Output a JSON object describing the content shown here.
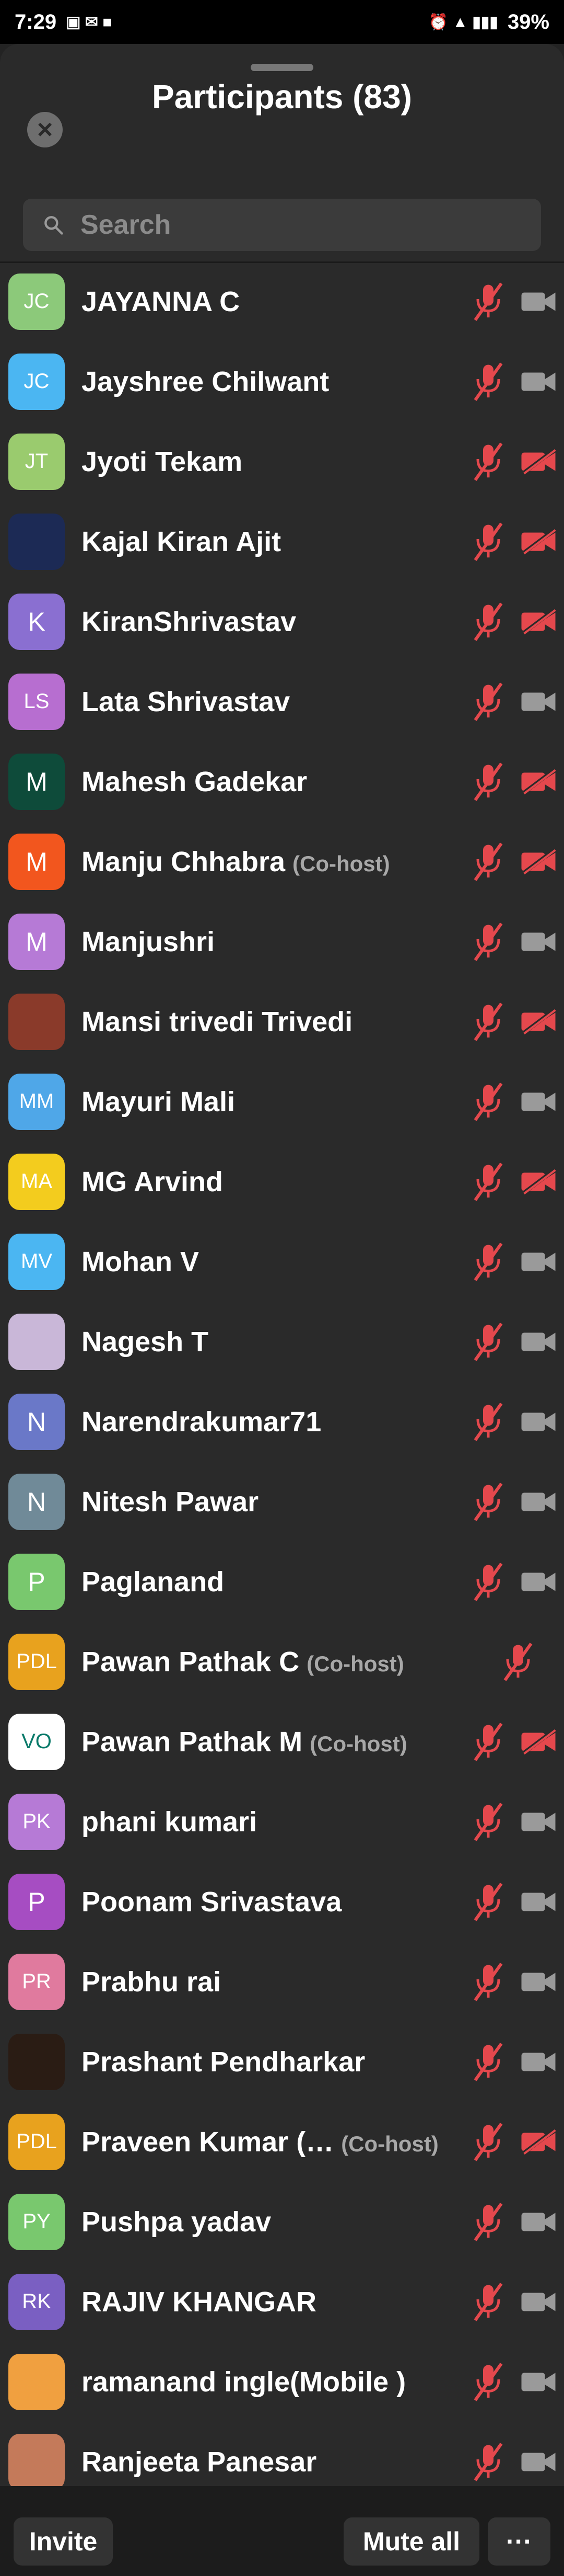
{
  "status_bar": {
    "time": "7:29",
    "battery": "39%"
  },
  "header": {
    "title": "Participants (83)"
  },
  "search": {
    "placeholder": "Search"
  },
  "colors": {
    "muted_red": "#e5484d",
    "video_on": "#9a9a9a",
    "background": "#2a2a2a"
  },
  "participants": [
    {
      "name": "JAYANNA C",
      "initials": "JC",
      "avatar_color": "#8cc97a",
      "video": "on"
    },
    {
      "name": "Jayshree Chilwant",
      "initials": "JC",
      "avatar_color": "#4bb6f2",
      "video": "on"
    },
    {
      "name": "Jyoti Tekam",
      "initials": "JT",
      "avatar_color": "#9acb6e",
      "video": "off"
    },
    {
      "name": "Kajal Kiran Ajit",
      "initials": "",
      "avatar_color": "#1c2a55",
      "video": "off"
    },
    {
      "name": "KiranShrivastav",
      "initials": "K",
      "avatar_color": "#8a6fd1",
      "video": "off"
    },
    {
      "name": "Lata Shrivastav",
      "initials": "LS",
      "avatar_color": "#b76ed0",
      "video": "on"
    },
    {
      "name": "Mahesh Gadekar",
      "initials": "M",
      "avatar_color": "#0e4b3a",
      "video": "off"
    },
    {
      "name": "Manju Chhabra",
      "cohost": "(Co-host)",
      "initials": "M",
      "avatar_color": "#f2561e",
      "video": "off"
    },
    {
      "name": "Manjushri",
      "initials": "M",
      "avatar_color": "#b67ad6",
      "video": "on"
    },
    {
      "name": "Mansi trivedi Trivedi",
      "initials": "",
      "avatar_color": "#8a3a2a",
      "video": "off"
    },
    {
      "name": "Mayuri Mali",
      "initials": "MM",
      "avatar_color": "#4fa7e8",
      "video": "on"
    },
    {
      "name": "MG Arvind",
      "initials": "MA",
      "avatar_color": "#f3cc1e",
      "video": "off"
    },
    {
      "name": "Mohan V",
      "initials": "MV",
      "avatar_color": "#4bb6f2",
      "video": "on"
    },
    {
      "name": "Nagesh T",
      "initials": "",
      "avatar_color": "#c9b7d8",
      "video": "on"
    },
    {
      "name": "Narendrakumar71",
      "initials": "N",
      "avatar_color": "#6a78c8",
      "video": "on"
    },
    {
      "name": "Nitesh Pawar",
      "initials": "N",
      "avatar_color": "#708a98",
      "video": "on"
    },
    {
      "name": "Paglanand",
      "initials": "P",
      "avatar_color": "#79c86e",
      "video": "on"
    },
    {
      "name": "Pawan Pathak C",
      "cohost": "(Co-host)",
      "initials": "PDL",
      "avatar_color": "#e8a21e",
      "video": "none"
    },
    {
      "name": "Pawan Pathak M",
      "cohost": "(Co-host)",
      "initials": "VO",
      "avatar_color": "#ffffff",
      "video": "off"
    },
    {
      "name": "phani kumari",
      "initials": "PK",
      "avatar_color": "#b67ad6",
      "video": "on"
    },
    {
      "name": "Poonam Srivastava",
      "initials": "P",
      "avatar_color": "#a64dc2",
      "video": "on"
    },
    {
      "name": "Prabhu rai",
      "initials": "PR",
      "avatar_color": "#e07a9e",
      "video": "on"
    },
    {
      "name": "Prashant Pendharkar",
      "initials": "",
      "avatar_color": "#2a1c14",
      "video": "on"
    },
    {
      "name": "Praveen Kumar (…",
      "cohost": "(Co-host)",
      "initials": "PDL",
      "avatar_color": "#e8a21e",
      "video": "off"
    },
    {
      "name": "Pushpa yadav",
      "initials": "PY",
      "avatar_color": "#79c86e",
      "video": "on"
    },
    {
      "name": "RAJIV KHANGAR",
      "initials": "RK",
      "avatar_color": "#7a5fc2",
      "video": "on"
    },
    {
      "name": "ramanand ingle(Mobile )",
      "initials": "",
      "avatar_color": "#f0a040",
      "video": "on"
    },
    {
      "name": "Ranjeeta Panesar",
      "initials": "",
      "avatar_color": "#c47a5a",
      "video": "on"
    }
  ],
  "footer": {
    "invite_label": "Invite",
    "mute_all_label": "Mute all",
    "more_label": "···"
  }
}
